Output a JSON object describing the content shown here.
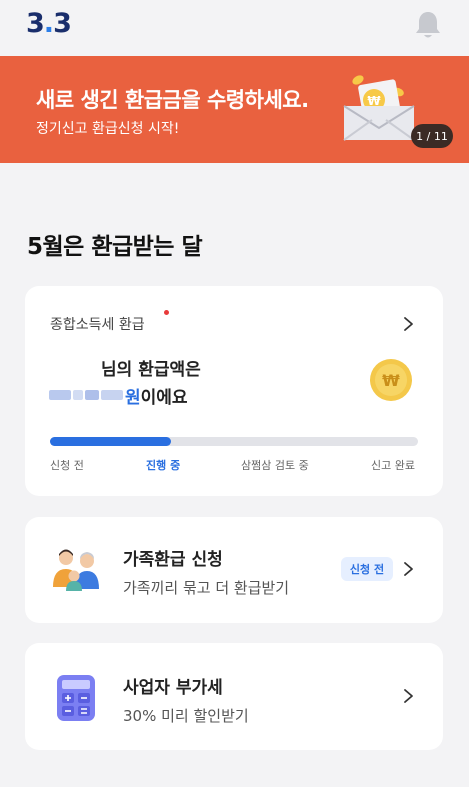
{
  "header": {
    "logo_main": "3",
    "logo_dot": ".",
    "logo_end": "3",
    "bell_icon": "bell-icon"
  },
  "banner": {
    "title": "새로 생긴 환급금을 수령하세요.",
    "subtitle": "정기신고 환급신청 시작!",
    "pager": "1 / 11",
    "background": "#e9613f",
    "art_icon": "envelope-money-icon"
  },
  "section": {
    "title": "5월은 환급받는 달"
  },
  "refund_card": {
    "label": "종합소득세 환급",
    "name_line": "님의 환급액은",
    "amount_won": "원",
    "amount_suffix": "이에요",
    "coin_icon": "won-coin-icon",
    "progress": 0.33,
    "steps": [
      "신청 전",
      "진행 중",
      "삼쩜삼 검토 중",
      "신고 완료"
    ],
    "active_step": 1,
    "accent": "#2a6fe0"
  },
  "family_card": {
    "title": "가족환급 신청",
    "subtitle": "가족끼리 묶고 더 환급받기",
    "badge": "신청 전",
    "icon": "family-icon"
  },
  "business_card": {
    "title": "사업자 부가세",
    "subtitle": "30% 미리 할인받기",
    "icon": "calculator-icon"
  }
}
